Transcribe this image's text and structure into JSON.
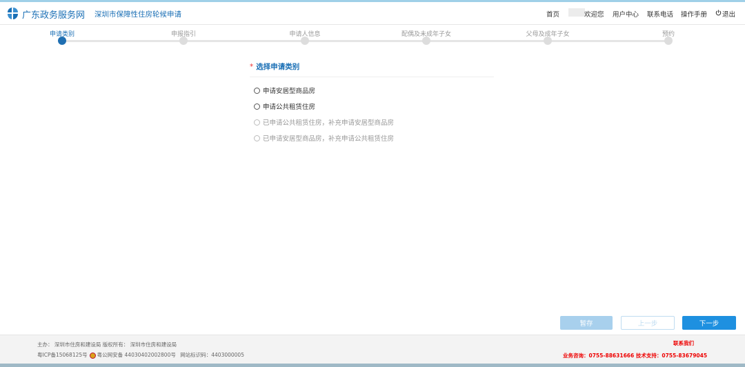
{
  "header": {
    "brand": "广东政务服务网",
    "sub_brand": "深圳市保障性住房轮候申请",
    "nav": {
      "home": "首页",
      "welcome": "欢迎您",
      "user_center": "用户中心",
      "contact_phone": "联系电话",
      "manual": "操作手册",
      "logout": "退出"
    }
  },
  "steps": [
    {
      "label": "申请类别",
      "active": true
    },
    {
      "label": "申报指引",
      "active": false
    },
    {
      "label": "申请人信息",
      "active": false
    },
    {
      "label": "配偶及未成年子女",
      "active": false
    },
    {
      "label": "父母及成年子女",
      "active": false
    },
    {
      "label": "预约",
      "active": false
    }
  ],
  "form": {
    "required_mark": "*",
    "title": "选择申请类别",
    "options": [
      {
        "label": "申请安居型商品房",
        "disabled": false
      },
      {
        "label": "申请公共租赁住房",
        "disabled": false
      },
      {
        "label": "已申请公共租赁住房，补充申请安居型商品房",
        "disabled": true
      },
      {
        "label": "已申请安居型商品房，补充申请公共租赁住房",
        "disabled": true
      }
    ]
  },
  "buttons": {
    "save": "暂存",
    "prev": "上一步",
    "next": "下一步"
  },
  "footer": {
    "sponsor": "主办：  深圳市住房和建设局  版权所有：  深圳市住房和建设局",
    "icp": "粤ICP备15068125号",
    "police": "粤公网安备 44030402002800号",
    "site_code": "网站标识码：4403000005",
    "contact_title": "联系我们",
    "contact_info": "业务咨询：0755-88631666  技术支持：0755-83679045"
  },
  "colors": {
    "brand_blue": "#1a6fb5",
    "step_active": "#1f6fb2",
    "next_button": "#1e90e0",
    "save_button": "#a8d0ed",
    "contact_red": "#e00000"
  }
}
